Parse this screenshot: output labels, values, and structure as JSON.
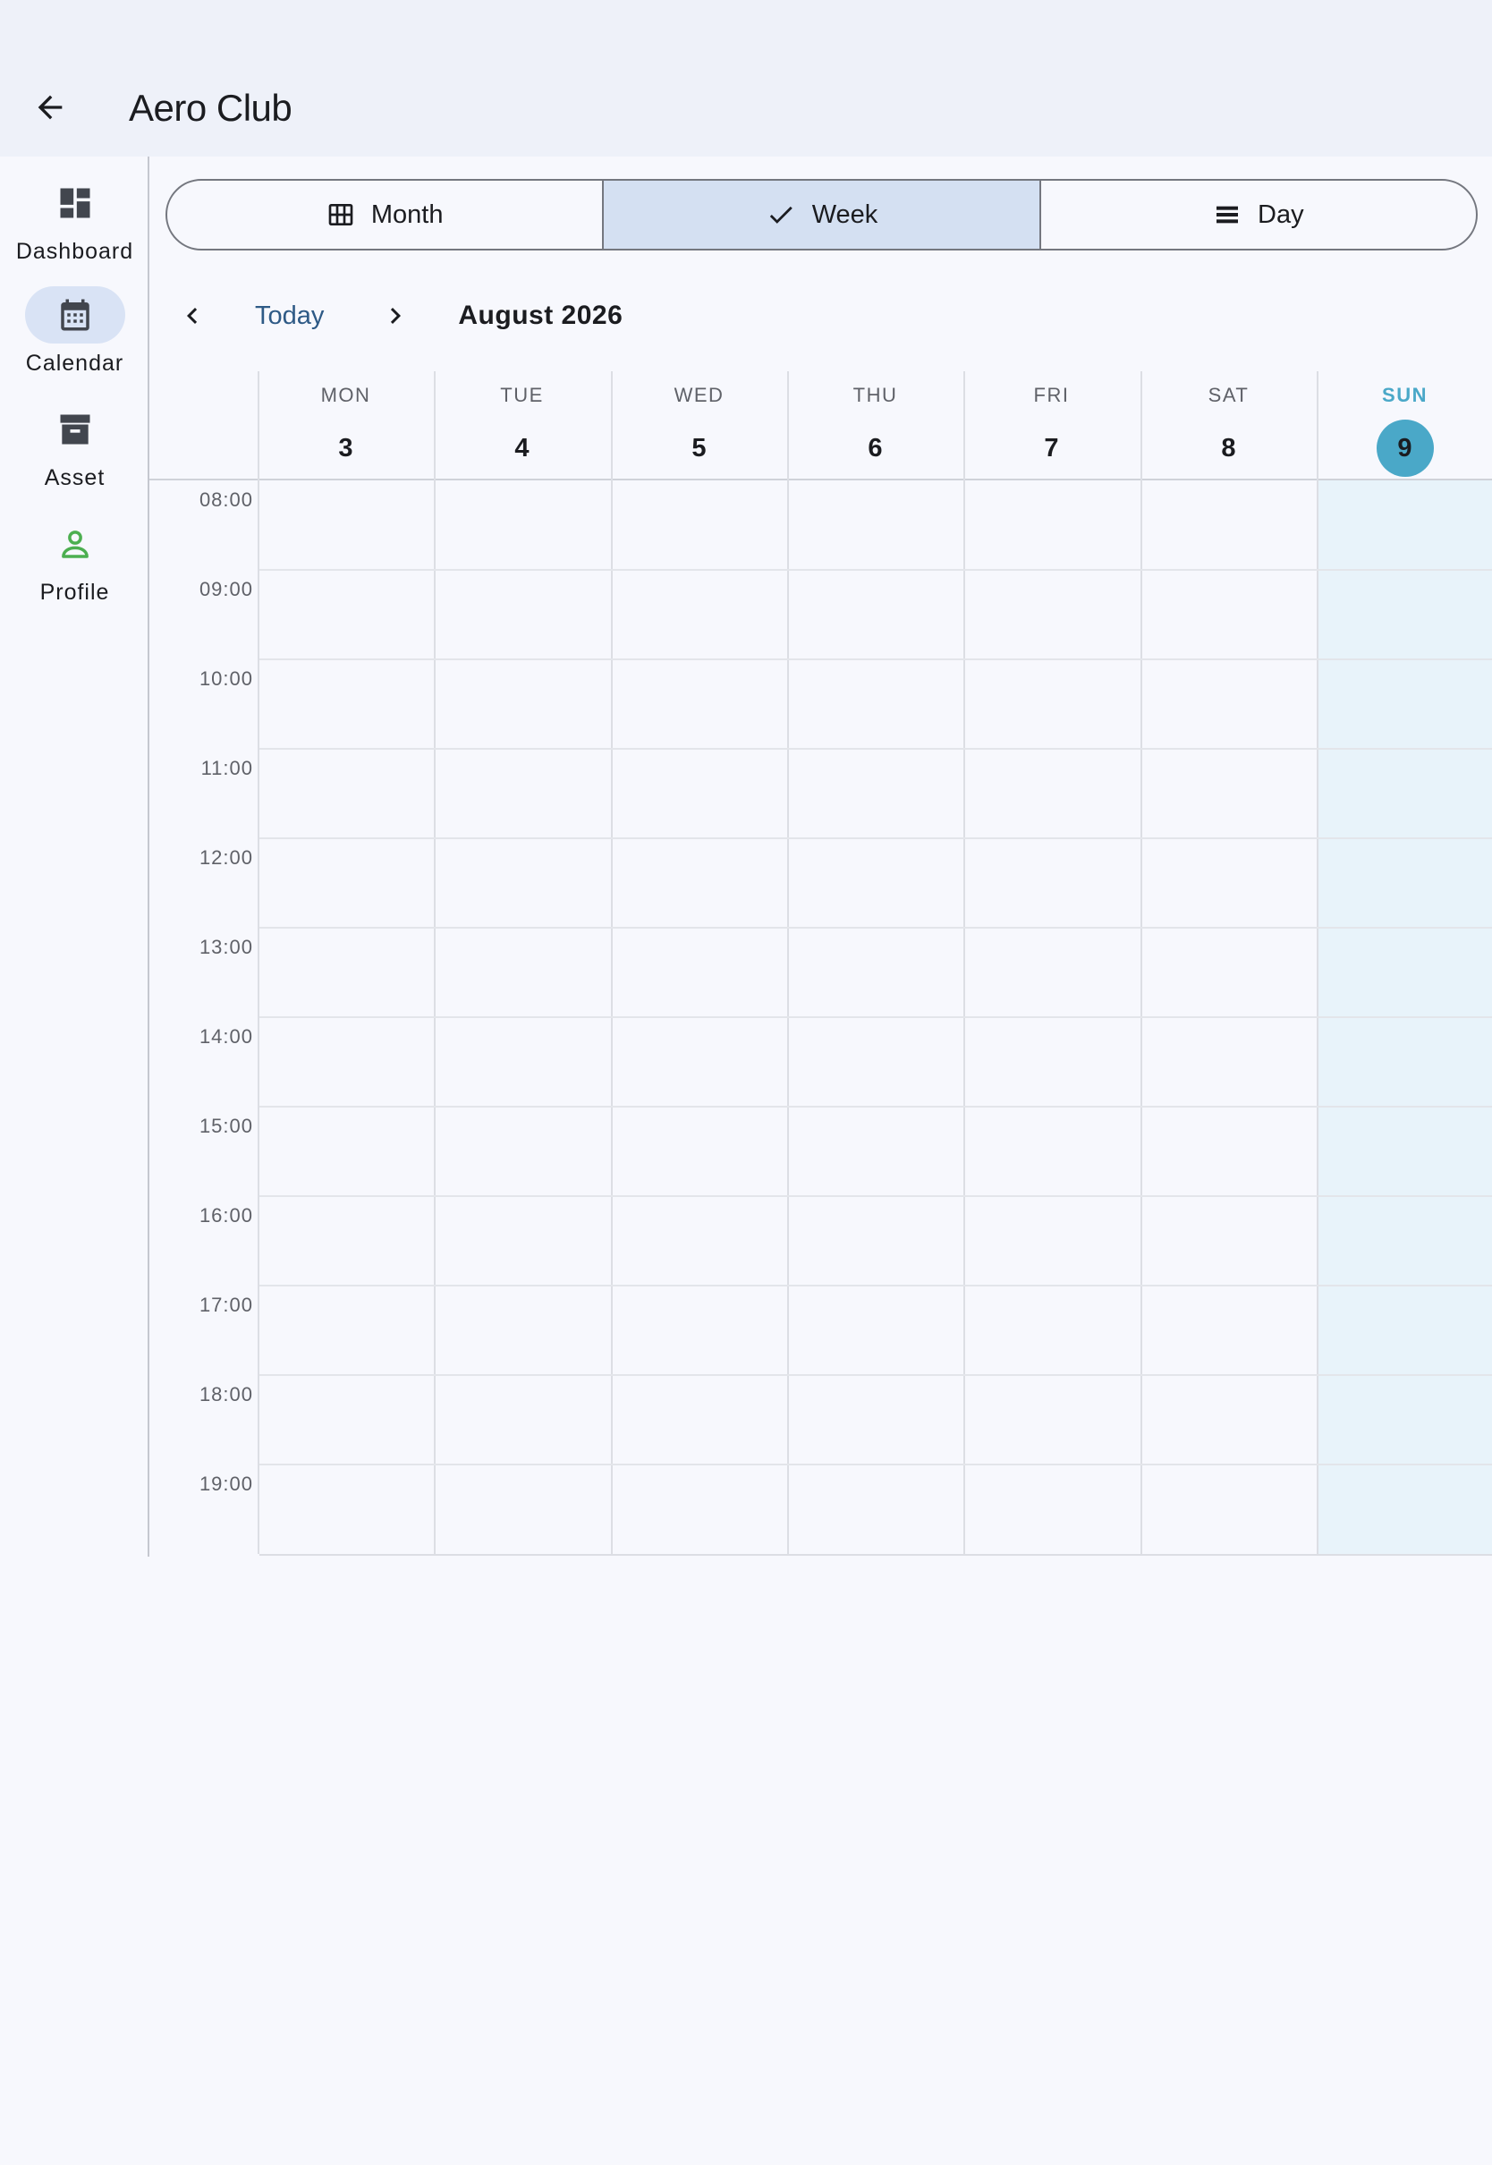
{
  "app_bar": {
    "title": "Aero Club",
    "back_icon": "arrow-back-icon"
  },
  "rail": {
    "items": [
      {
        "label": "Dashboard",
        "icon": "dashboard-icon",
        "active": false
      },
      {
        "label": "Calendar",
        "icon": "calendar-icon",
        "active": true
      },
      {
        "label": "Asset",
        "icon": "archive-icon",
        "active": false
      },
      {
        "label": "Profile",
        "icon": "person-icon",
        "active": false,
        "color": "#4caf50"
      }
    ]
  },
  "view_toggle": {
    "options": [
      {
        "label": "Month",
        "icon": "grid-icon",
        "selected": false
      },
      {
        "label": "Week",
        "icon": "check-icon",
        "selected": true
      },
      {
        "label": "Day",
        "icon": "list-icon",
        "selected": false
      }
    ]
  },
  "nav": {
    "today_label": "Today",
    "month_label": "August 2026"
  },
  "week": {
    "days": [
      {
        "name": "MON",
        "num": "3"
      },
      {
        "name": "TUE",
        "num": "4"
      },
      {
        "name": "WED",
        "num": "5"
      },
      {
        "name": "THU",
        "num": "6"
      },
      {
        "name": "FRI",
        "num": "7"
      },
      {
        "name": "SAT",
        "num": "8"
      },
      {
        "name": "SUN",
        "num": "9",
        "today": true
      }
    ],
    "hours": [
      "08:00",
      "09:00",
      "10:00",
      "11:00",
      "12:00",
      "13:00",
      "14:00",
      "15:00",
      "16:00",
      "17:00",
      "18:00",
      "19:00"
    ]
  },
  "colors": {
    "accent": "#4aa8c8",
    "selected_segment": "#d4e0f2",
    "today_column": "#e8f3fa",
    "link": "#2e5a86"
  }
}
